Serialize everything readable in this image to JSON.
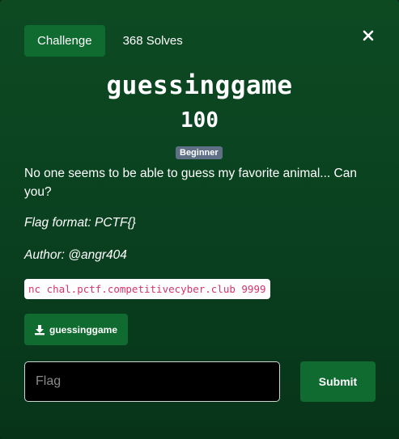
{
  "modal": {
    "close_icon": "close-icon"
  },
  "tabs": {
    "challenge_label": "Challenge",
    "solves_label": "368 Solves"
  },
  "challenge": {
    "name": "guessinggame",
    "points": "100",
    "difficulty": "Beginner",
    "description": "No one seems to be able to guess my favorite animal... Can you?",
    "flag_format": "Flag format: PCTF{}",
    "author": "Author: @angr404",
    "connection": "nc chal.pctf.competitivecyber.club 9999"
  },
  "download": {
    "icon": "download-icon",
    "label": "guessinggame"
  },
  "submission": {
    "placeholder": "Flag",
    "value": "",
    "submit_label": "Submit"
  },
  "colors": {
    "accent": "#0f6b2f",
    "badge": "#5e6f86",
    "code_text": "#d6336c"
  }
}
